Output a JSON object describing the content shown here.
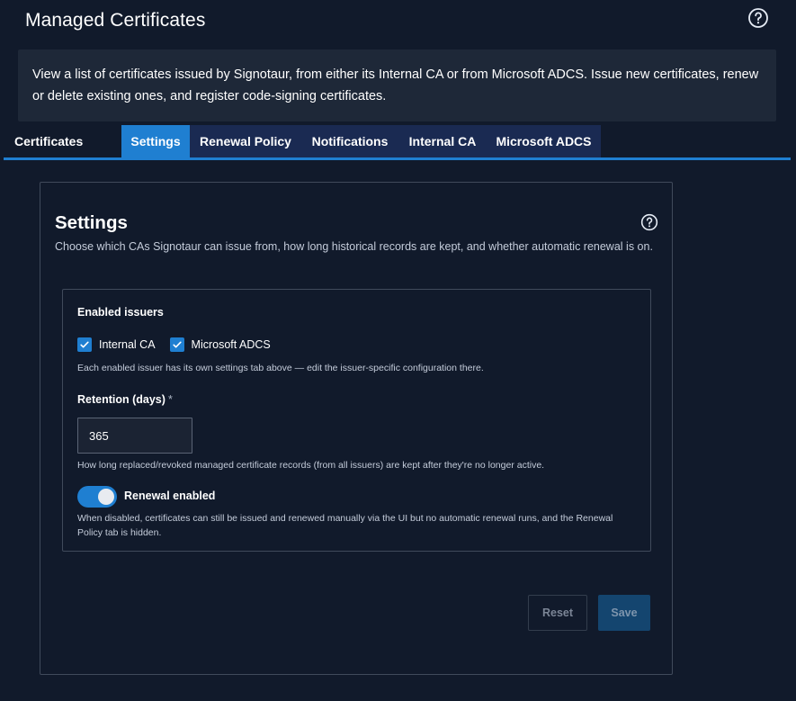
{
  "header": {
    "title": "Managed Certificates",
    "help_icon": "question-circle-icon"
  },
  "banner": {
    "text": "View a list of certificates issued by Signotaur, from either its Internal CA or from Microsoft ADCS. Issue new certificates, renew or delete existing ones, and register code-signing certificates."
  },
  "tabs": [
    {
      "label": "Certificates",
      "active": false
    },
    {
      "label": "Settings",
      "active": true
    },
    {
      "label": "Renewal Policy",
      "active": false
    },
    {
      "label": "Notifications",
      "active": false
    },
    {
      "label": "Internal CA",
      "active": false
    },
    {
      "label": "Microsoft ADCS",
      "active": false
    }
  ],
  "settings": {
    "title": "Settings",
    "help_icon": "question-circle-icon",
    "description": "Choose which CAs Signotaur can issue from, how long historical records are kept, and whether automatic renewal is on.",
    "issuers": {
      "label": "Enabled issuers",
      "options": [
        {
          "label": "Internal CA",
          "checked": true
        },
        {
          "label": "Microsoft ADCS",
          "checked": true
        }
      ],
      "hint": "Each enabled issuer has its own settings tab above — edit the issuer-specific configuration there."
    },
    "retention": {
      "label": "Retention (days)",
      "required_mark": "*",
      "value": "365",
      "hint": "How long replaced/revoked managed certificate records (from all issuers) are kept after they're no longer active."
    },
    "renewal": {
      "label": "Renewal enabled",
      "enabled": true,
      "hint": "When disabled, certificates can still be issued and renewed manually via the UI but no automatic renewal runs, and the Renewal Policy tab is hidden."
    },
    "actions": {
      "reset_label": "Reset",
      "save_label": "Save"
    }
  },
  "colors": {
    "background": "#111a2b",
    "accent": "#1f7fd1",
    "tab_dark": "#1a2a52",
    "banner": "#1e2838"
  }
}
